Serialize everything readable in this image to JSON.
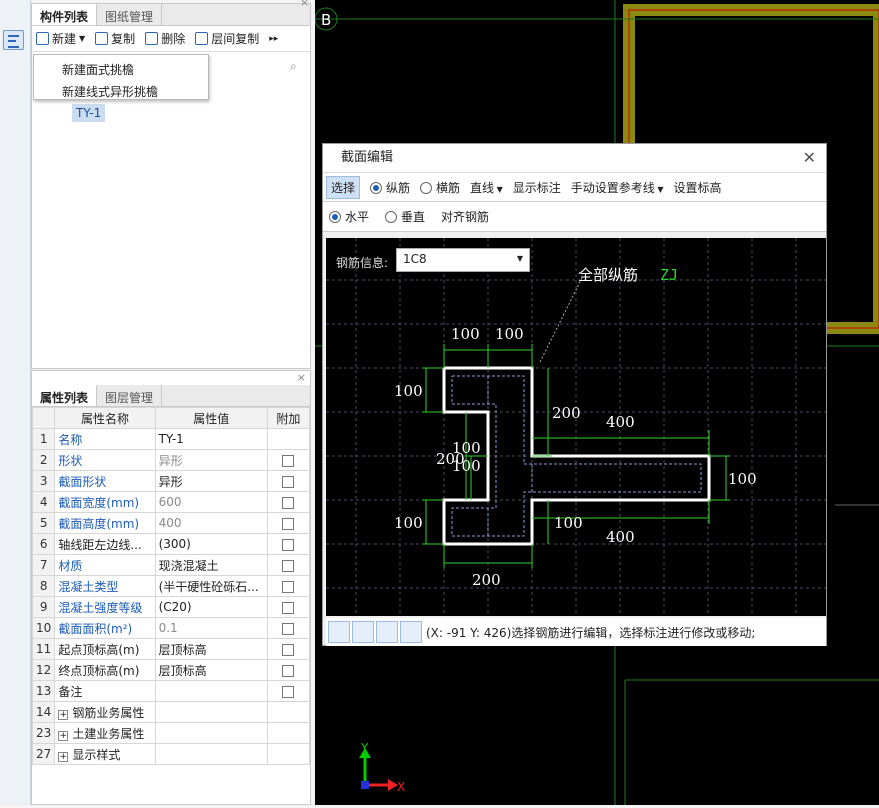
{
  "left_panel": {
    "tabs": [
      "构件列表",
      "图纸管理"
    ],
    "toolbar": {
      "new": "新建",
      "copy": "复制",
      "delete": "删除",
      "floor_copy": "层间复制"
    },
    "new_menu": [
      "新建面式挑檐",
      "新建线式异形挑檐"
    ],
    "item": "TY-1"
  },
  "props_panel": {
    "tabs": [
      "属性列表",
      "图层管理"
    ],
    "headers": [
      "属性名称",
      "属性值",
      "附加"
    ],
    "rows": [
      {
        "n": "1",
        "name": "名称",
        "value": "TY-1",
        "cb": false
      },
      {
        "n": "2",
        "name": "形状",
        "value": "异形",
        "cb": true
      },
      {
        "n": "3",
        "name": "截面形状",
        "value": "异形",
        "cb": true
      },
      {
        "n": "4",
        "name": "截面宽度(mm)",
        "value": "600",
        "cb": true
      },
      {
        "n": "5",
        "name": "截面高度(mm)",
        "value": "400",
        "cb": true
      },
      {
        "n": "6",
        "name": "轴线距左边线...",
        "value": "(300)",
        "cb": true
      },
      {
        "n": "7",
        "name": "材质",
        "value": "现浇混凝土",
        "cb": true
      },
      {
        "n": "8",
        "name": "混凝土类型",
        "value": "(半干硬性砼砾石...",
        "cb": true
      },
      {
        "n": "9",
        "name": "混凝土强度等级",
        "value": "(C20)",
        "cb": true
      },
      {
        "n": "10",
        "name": "截面面积(m²)",
        "value": "0.1",
        "cb": true
      },
      {
        "n": "11",
        "name": "起点顶标高(m)",
        "value": "层顶标高",
        "cb": true
      },
      {
        "n": "12",
        "name": "终点顶标高(m)",
        "value": "层顶标高",
        "cb": true
      },
      {
        "n": "13",
        "name": "备注",
        "value": "",
        "cb": true
      },
      {
        "n": "14",
        "name": "钢筋业务属性",
        "value": "",
        "cb": false
      },
      {
        "n": "23",
        "name": "土建业务属性",
        "value": "",
        "cb": false
      },
      {
        "n": "27",
        "name": "显示样式",
        "value": "",
        "cb": false
      }
    ]
  },
  "cad": {
    "axis_label": "B",
    "axis_x": "X",
    "axis_y": "Y"
  },
  "dialog": {
    "title": "截面编辑",
    "toolbar1": {
      "select": "选择",
      "long_bar": "纵筋",
      "cross_bar": "横筋",
      "line": "直线",
      "show_dim": "显示标注",
      "manual_ref": "手动设置参考线",
      "set_elev": "设置标高"
    },
    "toolbar2": {
      "horizontal": "水平",
      "vertical": "垂直",
      "align": "对齐钢筋"
    },
    "rebar_label": "钢筋信息:",
    "rebar_value": "1C8",
    "annotation": "全部纵筋",
    "annotation_code": "ZJ",
    "dims": {
      "top_a": "100",
      "top_b": "100",
      "left_top": "100",
      "mid_200": "200",
      "right_400_top": "400",
      "overlap_100a": "100",
      "overlap_200": "200",
      "overlap_100b": "100",
      "right_100": "100",
      "left_bottom": "100",
      "bottom_100": "100",
      "right_400_bottom": "400",
      "bottom_200": "200"
    },
    "status": "(X: -91 Y: 426)选择钢筋进行编辑，选择标注进行修改或移动;"
  }
}
